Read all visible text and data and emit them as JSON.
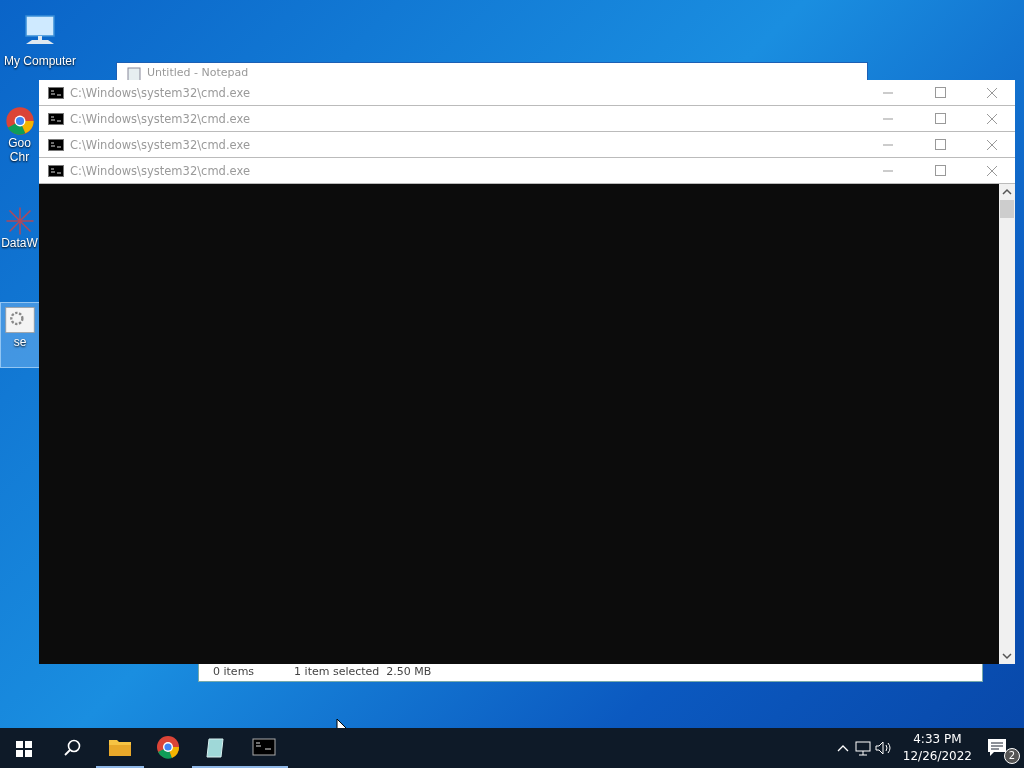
{
  "desktop_icons": [
    {
      "kind": "computer",
      "lines": [
        "My Computer"
      ],
      "selected": false
    },
    {
      "kind": "chrome",
      "lines": [
        "Goo",
        "Chr"
      ],
      "selected": false
    },
    {
      "kind": "network",
      "lines": [
        "DataW"
      ],
      "selected": false
    },
    {
      "kind": "settings",
      "lines": [
        "se"
      ],
      "selected": true
    }
  ],
  "notepad": {
    "title": "Untitled - Notepad"
  },
  "explorer": {
    "status": [
      "0 items",
      "1 item selected  2.50 MB"
    ]
  },
  "cmd_windows": [
    {
      "title": "C:\\Windows\\system32\\cmd.exe"
    },
    {
      "title": "C:\\Windows\\system32\\cmd.exe"
    },
    {
      "title": "C:\\Windows\\system32\\cmd.exe"
    },
    {
      "title": "C:\\Windows\\system32\\cmd.exe"
    }
  ],
  "taskbar": {
    "apps": [
      {
        "kind": "explorer",
        "running": true
      },
      {
        "kind": "chrome",
        "running": false
      },
      {
        "kind": "notepad",
        "running": true
      },
      {
        "kind": "cmd",
        "running": true
      }
    ],
    "time": "4:33 PM",
    "date": "12/26/2022",
    "notifications": "2"
  }
}
